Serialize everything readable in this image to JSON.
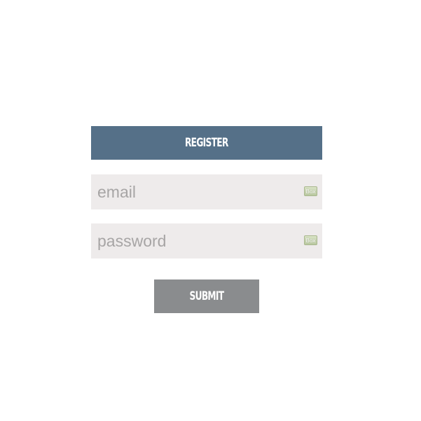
{
  "form": {
    "header_label": "REGISTER",
    "email": {
      "placeholder": "email",
      "value": "",
      "badge_icon": "box-icon",
      "badge_label": "Box"
    },
    "password": {
      "placeholder": "password",
      "value": "",
      "badge_icon": "box-icon",
      "badge_label": "Box"
    },
    "submit_label": "SUBMIT"
  },
  "colors": {
    "header_bg": "#557088",
    "field_bg": "#eeebeb",
    "placeholder": "#a7a5a5",
    "submit_bg": "#8a8c8e",
    "text_on_dark": "#ffffff"
  }
}
